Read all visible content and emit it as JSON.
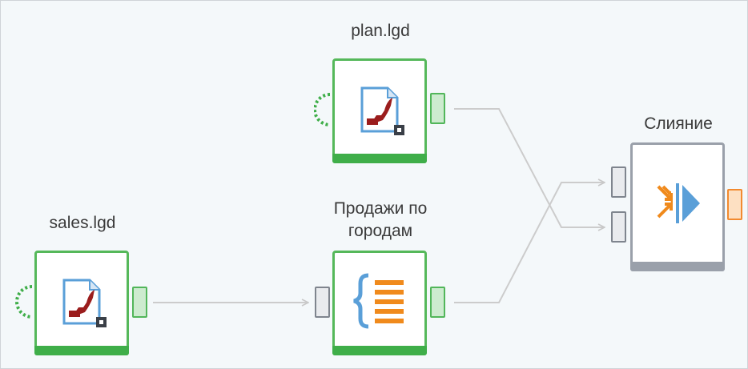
{
  "nodes": {
    "plan": {
      "label": "plan.lgd",
      "kind": "logical-data-file"
    },
    "sales": {
      "label": "sales.lgd",
      "kind": "logical-data-file"
    },
    "city_sales": {
      "label": "Продажи по\nгородам",
      "kind": "calculator"
    },
    "merge": {
      "label": "Слияние",
      "kind": "merge"
    }
  },
  "colors": {
    "node_border_green": "#55b85a",
    "node_bar_green": "#3fae49",
    "merge_gray": "#9aa0aa",
    "link_gray": "#cccccc",
    "port_orange": "#f28a2f",
    "icon_blue": "#5a9fd8",
    "icon_red": "#9b1d1d",
    "icon_orange": "#f08a1c"
  },
  "links": [
    {
      "from": "sales",
      "to": "city_sales"
    },
    {
      "from": "plan",
      "to": "merge.input_2"
    },
    {
      "from": "city_sales",
      "to": "merge.input_1"
    }
  ]
}
